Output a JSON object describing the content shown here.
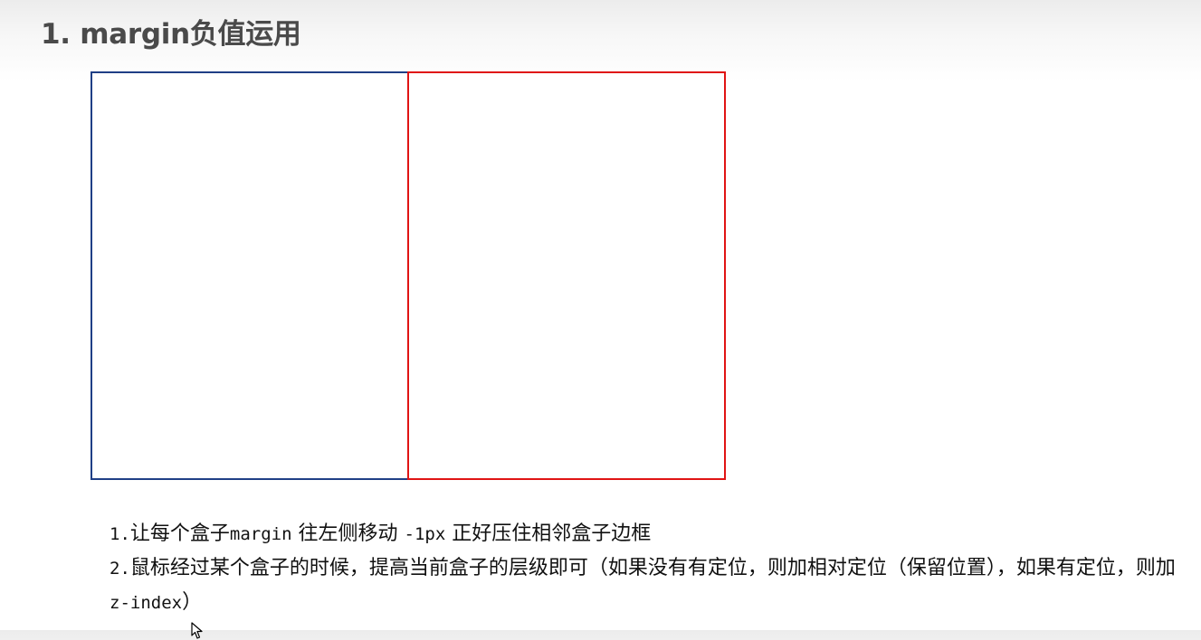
{
  "slide": {
    "title": "1. margin负值运用"
  },
  "demo": {
    "left_box_color": "#1f3f86",
    "right_box_color": "#e01414"
  },
  "notes": [
    {
      "num": "1.",
      "text_a": "让每个盒子",
      "code_a": "margin",
      "text_b": " 往左侧移动 ",
      "code_b": "-1px",
      "text_c": " 正好压住相邻盒子边框"
    },
    {
      "num": "2.",
      "text_a": "鼠标经过某个盒子的时候，提高当前盒子的层级即可（如果没有有定位，则加相对定位（保留位置），如果有定位，则加",
      "code_a": "z-index",
      "text_b": "）"
    }
  ],
  "pointer": {
    "icon": "mouse-pointer-icon"
  }
}
